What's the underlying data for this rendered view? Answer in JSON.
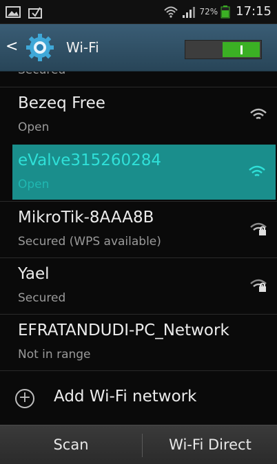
{
  "status_bar": {
    "left_icons": [
      "gallery-icon",
      "clipboard-icon"
    ],
    "right_icons": [
      "wifi-status-icon",
      "signal-icon",
      "battery-icon"
    ],
    "battery_percent": "72%",
    "time": "17:15"
  },
  "action_bar": {
    "title": "Wi-Fi",
    "wifi_toggle_on": true,
    "accent_color": "#3bb024"
  },
  "networks": {
    "cut_off_status": "Secured",
    "items": [
      {
        "name": "Bezeq Free",
        "status": "Open",
        "secured": false,
        "selected": false
      },
      {
        "name": "eValve315260284",
        "status": "Open",
        "secured": false,
        "selected": true
      },
      {
        "name": "MikroTik-8AAA8B",
        "status": "Secured (WPS available)",
        "secured": true,
        "selected": false
      },
      {
        "name": "Yael",
        "status": "Secured",
        "secured": true,
        "selected": false
      },
      {
        "name": "EFRATANDUDI-PC_Network",
        "status": "Not in range",
        "secured": false,
        "selected": false
      }
    ],
    "selected_color": "#1a8e8c"
  },
  "add_network": {
    "label": "Add Wi-Fi network",
    "icon": "plus-circle-icon"
  },
  "bottom_bar": {
    "scan_label": "Scan",
    "wifi_direct_label": "Wi-Fi Direct"
  }
}
